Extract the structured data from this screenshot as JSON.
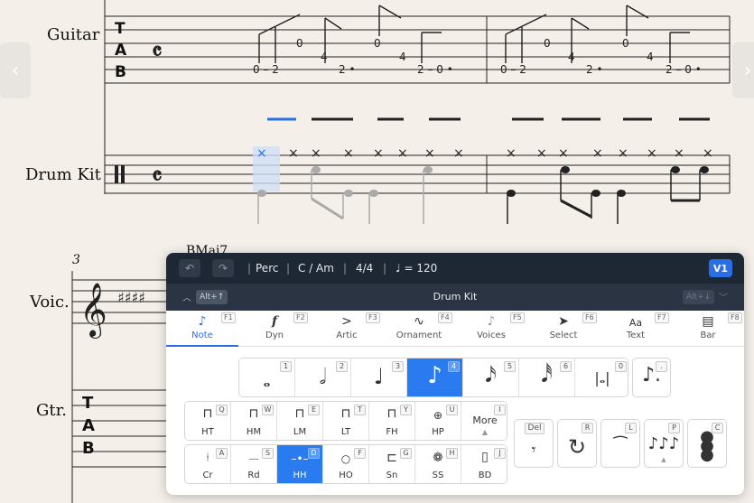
{
  "score": {
    "instruments": [
      "Guitar",
      "Drum Kit",
      "Voic.",
      "Gtr."
    ],
    "tab_letters": [
      "T",
      "A",
      "B"
    ],
    "measure_number": "3",
    "chord_symbol": "BMaj7",
    "time_signature": "C"
  },
  "nav": {
    "prev": "‹",
    "next": "›"
  },
  "palette": {
    "toolbar": {
      "undo_icon": "undo-icon",
      "redo_icon": "redo-icon",
      "instrument": "Perc",
      "key": "C / Am",
      "time": "4/4",
      "tempo": "♩ = 120",
      "voice": "V1",
      "sep": "|"
    },
    "subbar": {
      "collapse_shortcut": "Alt+↑",
      "title": "Drum Kit",
      "expand_shortcut": "Alt+↓"
    },
    "tabs": [
      {
        "label": "Note",
        "key": "F1",
        "icon": "note-icon"
      },
      {
        "label": "Dyn",
        "key": "F2",
        "icon": "dynamics-icon"
      },
      {
        "label": "Artic",
        "key": "F3",
        "icon": "accent-icon"
      },
      {
        "label": "Ornament",
        "key": "F4",
        "icon": "trill-icon"
      },
      {
        "label": "Voices",
        "key": "F5",
        "icon": "voices-icon"
      },
      {
        "label": "Select",
        "key": "F6",
        "icon": "cursor-icon"
      },
      {
        "label": "Text",
        "key": "F7",
        "icon": "text-icon"
      },
      {
        "label": "Bar",
        "key": "F8",
        "icon": "bar-icon"
      }
    ],
    "durations": [
      {
        "key": "1",
        "name": "whole"
      },
      {
        "key": "2",
        "name": "half"
      },
      {
        "key": "3",
        "name": "quarter"
      },
      {
        "key": "4",
        "name": "eighth",
        "selected": true
      },
      {
        "key": "5",
        "name": "sixteenth"
      },
      {
        "key": "6",
        "name": "thirty-second"
      },
      {
        "key": "0",
        "name": "breve"
      }
    ],
    "dot_key": ".",
    "drums_row1": [
      {
        "label": "HT",
        "key": "Q"
      },
      {
        "label": "HM",
        "key": "W"
      },
      {
        "label": "LM",
        "key": "E"
      },
      {
        "label": "LT",
        "key": "T"
      },
      {
        "label": "FH",
        "key": "Y"
      },
      {
        "label": "HP",
        "key": "U"
      },
      {
        "label": "More",
        "key": "I"
      }
    ],
    "drums_row2": [
      {
        "label": "Cr",
        "key": "A"
      },
      {
        "label": "Rd",
        "key": "S"
      },
      {
        "label": "HH",
        "key": "D",
        "selected": true
      },
      {
        "label": "HO",
        "key": "F"
      },
      {
        "label": "Sn",
        "key": "G"
      },
      {
        "label": "SS",
        "key": "H"
      },
      {
        "label": "BD",
        "key": "J"
      }
    ],
    "tools": [
      {
        "name": "rest",
        "key": "Del"
      },
      {
        "name": "repeat",
        "key": "R"
      },
      {
        "name": "tie",
        "key": "L"
      },
      {
        "name": "tuplet",
        "key": "P"
      },
      {
        "name": "chord",
        "key": "C"
      }
    ]
  }
}
